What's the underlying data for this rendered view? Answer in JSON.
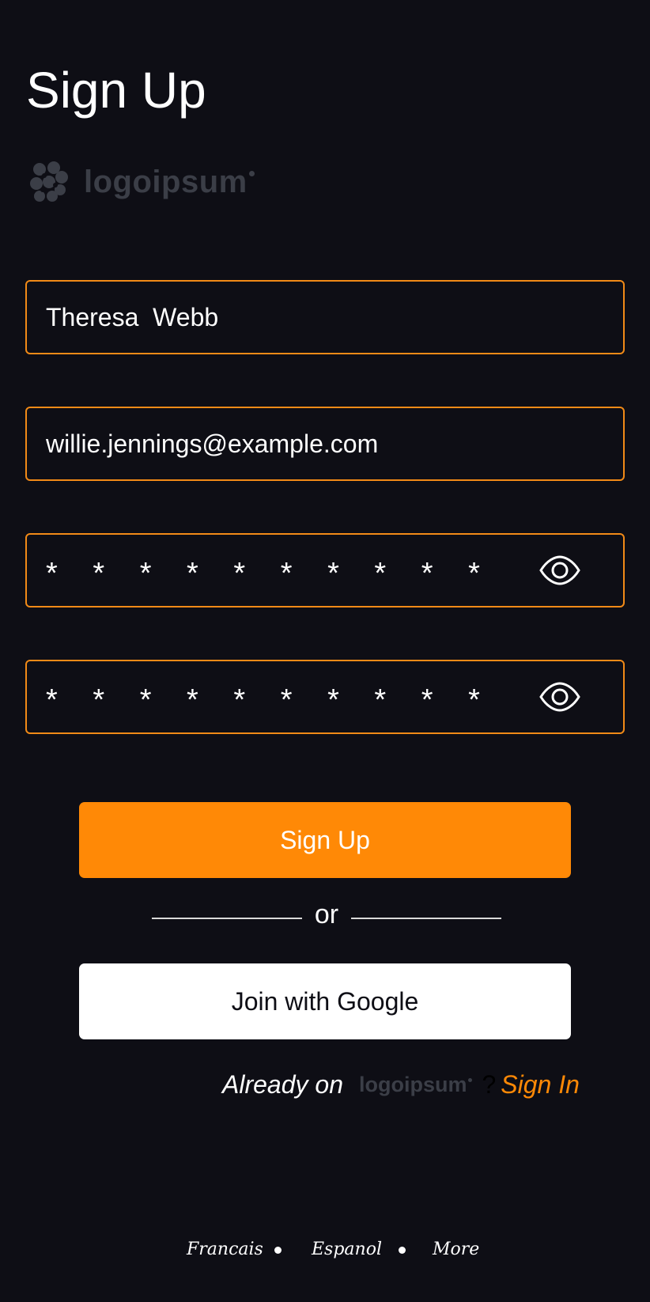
{
  "header": {
    "title": "Sign Up"
  },
  "brand": {
    "name": "logoipsum",
    "icon": "logo-mark-icon",
    "color": "#3b3e47"
  },
  "form": {
    "full_name": {
      "value": "Theresa  Webb"
    },
    "email": {
      "value": "willie.jennings@example.com"
    },
    "password": {
      "masked": "* * * * * * * * * *",
      "toggle_icon": "eye-icon"
    },
    "confirm_password": {
      "masked": "* * * * * * * * * *",
      "toggle_icon": "eye-icon"
    },
    "border_color": "#f18a17"
  },
  "actions": {
    "signup_label": "Sign Up",
    "divider_label": "or",
    "google_label": "Join with Google",
    "accent_color": "#ff8906"
  },
  "signin_prompt": {
    "prefix": "Already on",
    "brand": "logoipsum",
    "question": "?",
    "link": "Sign In"
  },
  "footer": {
    "languages": [
      "Francais",
      "Espanol",
      "More"
    ]
  },
  "colors": {
    "background": "#0e0e15",
    "text": "#ffffff"
  }
}
